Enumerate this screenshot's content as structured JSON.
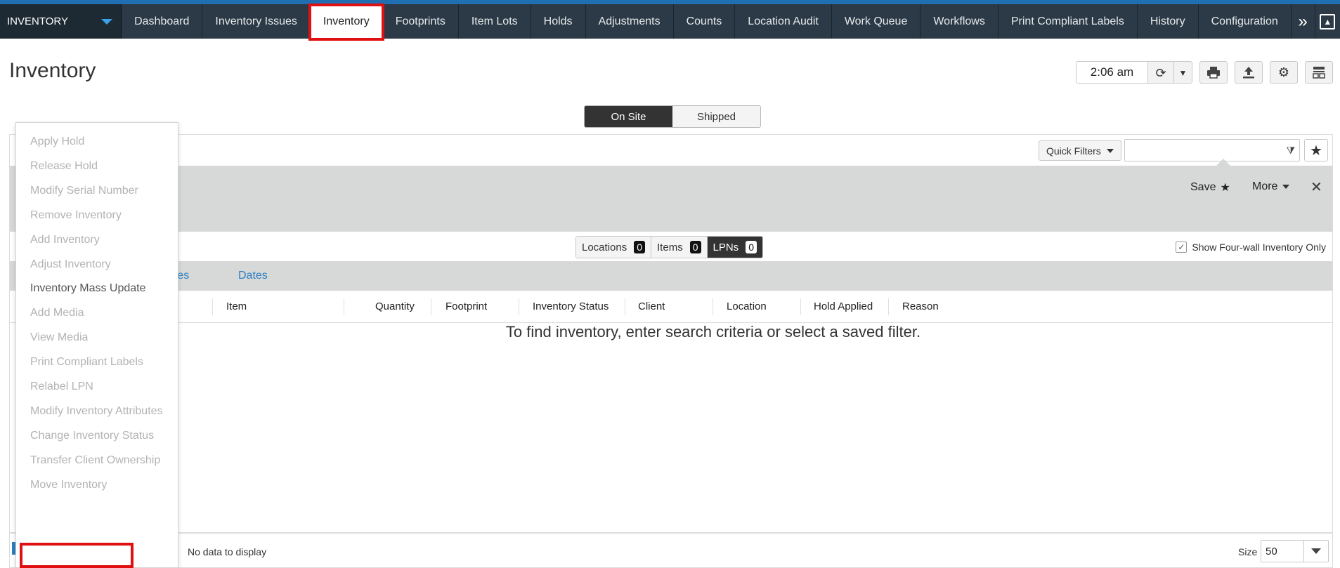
{
  "app_selector": {
    "label": "INVENTORY"
  },
  "nav": {
    "tabs": [
      {
        "label": "Dashboard",
        "active": false
      },
      {
        "label": "Inventory Issues",
        "active": false
      },
      {
        "label": "Inventory",
        "active": true
      },
      {
        "label": "Footprints",
        "active": false
      },
      {
        "label": "Item Lots",
        "active": false
      },
      {
        "label": "Holds",
        "active": false
      },
      {
        "label": "Adjustments",
        "active": false
      },
      {
        "label": "Counts",
        "active": false
      },
      {
        "label": "Location Audit",
        "active": false
      },
      {
        "label": "Work Queue",
        "active": false
      },
      {
        "label": "Workflows",
        "active": false
      },
      {
        "label": "Print Compliant Labels",
        "active": false
      },
      {
        "label": "History",
        "active": false
      },
      {
        "label": "Configuration",
        "active": false
      }
    ],
    "more_glyph": "»"
  },
  "header": {
    "title": "Inventory",
    "time": "2:06 am"
  },
  "segment": {
    "on_site": "On Site",
    "shipped": "Shipped",
    "selected": "On Site"
  },
  "filters": {
    "quick_filters_label": "Quick Filters",
    "search_value": "",
    "save_label": "Save",
    "more_label": "More"
  },
  "counts": {
    "locations_label": "Locations",
    "locations_count": "0",
    "items_label": "Items",
    "items_count": "0",
    "lpns_label": "LPNs",
    "lpns_count": "0",
    "selected": "LPNs"
  },
  "four_wall": {
    "label": "Show Four-wall Inventory Only",
    "checked": true
  },
  "subtabs": {
    "attributes_partial": "utes",
    "dates": "Dates"
  },
  "columns": [
    "Item",
    "Quantity",
    "Footprint",
    "Inventory Status",
    "Client",
    "Location",
    "Hold Applied",
    "Reason"
  ],
  "empty_message": "To find inventory, enter search criteria or select a saved filter.",
  "footer": {
    "no_data": "No data to display",
    "size_label": "Size",
    "size_value": "50"
  },
  "menu": {
    "items": [
      {
        "label": "Apply Hold",
        "enabled": false
      },
      {
        "label": "Release Hold",
        "enabled": false
      },
      {
        "label": "Modify Serial Number",
        "enabled": false
      },
      {
        "label": "Remove Inventory",
        "enabled": false
      },
      {
        "label": "Add Inventory",
        "enabled": false
      },
      {
        "label": "Adjust Inventory",
        "enabled": false
      },
      {
        "label": "Inventory Mass Update",
        "enabled": true
      },
      {
        "label": "Add Media",
        "enabled": false
      },
      {
        "label": "View Media",
        "enabled": false
      },
      {
        "label": "Print Compliant Labels",
        "enabled": false
      },
      {
        "label": "Relabel LPN",
        "enabled": false
      },
      {
        "label": "Modify Inventory Attributes",
        "enabled": false
      },
      {
        "label": "Change Inventory Status",
        "enabled": false
      },
      {
        "label": "Transfer Client Ownership",
        "enabled": false
      },
      {
        "label": "Move Inventory",
        "enabled": false
      }
    ]
  },
  "colors": {
    "nav_bg": "#2b3a46",
    "accent_blue": "#2d7fc1",
    "highlight_red": "#e01010",
    "filter_bg": "#d7d8d8"
  }
}
